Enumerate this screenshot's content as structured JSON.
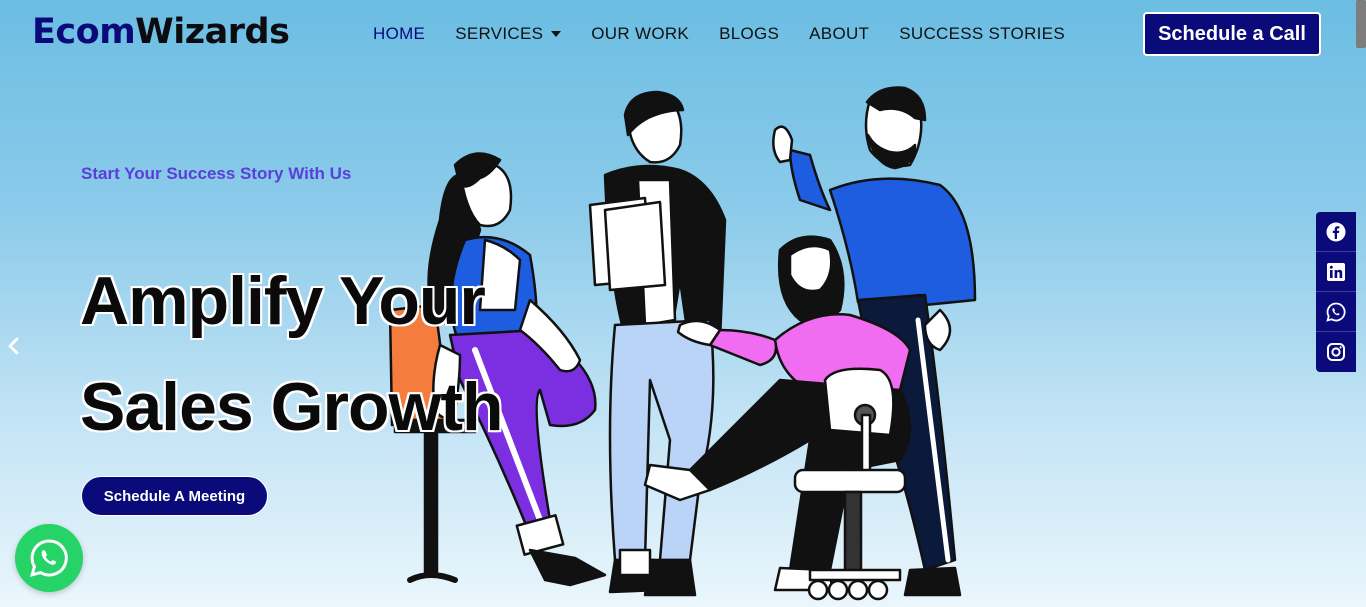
{
  "brand": {
    "name_part1": "Ecom",
    "name_part2": "Wizards"
  },
  "nav": {
    "items": [
      {
        "label": "HOME",
        "active": true
      },
      {
        "label": "SERVICES",
        "has_dropdown": true
      },
      {
        "label": "OUR WORK"
      },
      {
        "label": "BLOGS"
      },
      {
        "label": "ABOUT"
      },
      {
        "label": "SUCCESS STORIES"
      }
    ],
    "cta_label": "Schedule a Call"
  },
  "hero": {
    "tagline": "Start Your Success Story With Us",
    "headline_line1": "Amplify Your",
    "headline_line2": "Sales Growth",
    "cta_label": "Schedule A Meeting"
  },
  "social": [
    "facebook-icon",
    "linkedin-icon",
    "whatsapp-icon",
    "instagram-icon"
  ],
  "colors": {
    "primary": "#0a0a7a",
    "accent": "#5a3fd8",
    "whatsapp": "#25d366"
  }
}
